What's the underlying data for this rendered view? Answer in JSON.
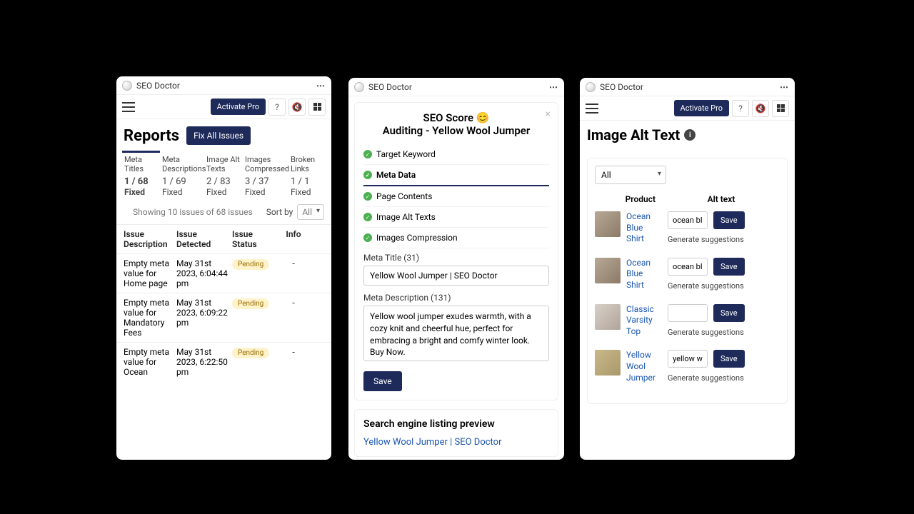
{
  "app_name": "SEO Doctor",
  "btn_activate": "Activate Pro",
  "panel1": {
    "title": "Reports",
    "fix_btn": "Fix All Issues",
    "tabs": [
      {
        "label": "Meta Titles",
        "count": "1 / 68",
        "fixed": "Fixed"
      },
      {
        "label": "Meta Descriptions",
        "count": "1 / 69",
        "fixed": "Fixed"
      },
      {
        "label": "Image Alt Texts",
        "count": "2 / 83",
        "fixed": "Fixed"
      },
      {
        "label": "Images Compressed",
        "count": "3 / 37",
        "fixed": "Fixed"
      },
      {
        "label": "Broken Links",
        "count": "1 / 1",
        "fixed": "Fixed"
      }
    ],
    "showing": "Showing 10 issues of 68 issues",
    "sort_label": "Sort by",
    "sort_value": "All",
    "cols": {
      "desc": "Issue Description",
      "det": "Issue Detected",
      "stat": "Issue Status",
      "info": "Info"
    },
    "rows": [
      {
        "desc": "Empty meta value for Home page",
        "det": "May 31st 2023, 6:04:44 pm",
        "stat": "Pending",
        "info": "-"
      },
      {
        "desc": "Empty meta value for Mandatory Fees",
        "det": "May 31st 2023, 6:09:22 pm",
        "stat": "Pending",
        "info": "-"
      },
      {
        "desc": "Empty meta value for Ocean",
        "det": "May 31st 2023, 6:22:50 pm",
        "stat": "Pending",
        "info": "-"
      }
    ]
  },
  "panel2": {
    "score_title": "SEO Score 😊",
    "subtitle": "Auditing - Yellow Wool Jumper",
    "checks": [
      "Target Keyword",
      "Meta Data",
      "Page Contents",
      "Image Alt Texts",
      "Images Compression"
    ],
    "meta_title_label": "Meta Title (31)",
    "meta_title_value": "Yellow Wool Jumper | SEO Doctor",
    "meta_desc_label": "Meta Description (131)",
    "meta_desc_value": "Yellow wool jumper exudes warmth, with a cozy knit and cheerful hue, perfect for embracing a bright and comfy winter look. Buy Now.",
    "save": "Save",
    "preview_title": "Search engine listing preview",
    "preview_link": "Yellow Wool Jumper | SEO Doctor"
  },
  "panel3": {
    "title": "Image Alt Text",
    "filter": "All",
    "col_product": "Product",
    "col_alt": "Alt text",
    "rows": [
      {
        "name": "Ocean Blue Shirt",
        "alt": "ocean bl"
      },
      {
        "name": "Ocean Blue Shirt",
        "alt": "ocean bl"
      },
      {
        "name": "Classic Varsity Top",
        "alt": ""
      },
      {
        "name": "Yellow Wool Jumper",
        "alt": "yellow w"
      }
    ],
    "save": "Save",
    "generate": "Generate suggestions"
  }
}
